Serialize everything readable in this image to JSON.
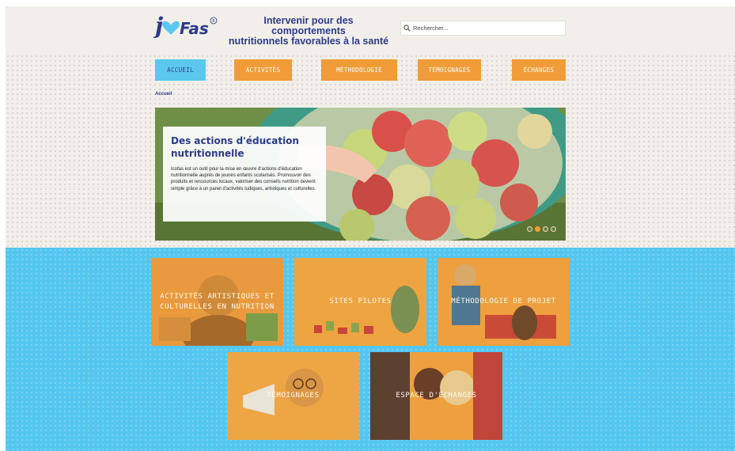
{
  "header": {
    "logo_text": "icofas",
    "tagline_line1": "Intervenir pour des comportements",
    "tagline_line2": "nutritionnels favorables à la santé",
    "search_placeholder": "Rechercher..."
  },
  "nav": [
    {
      "label": "ACCUEIL",
      "active": true
    },
    {
      "label": "ACTIVITÉS",
      "active": false
    },
    {
      "label": "MÉTHODOLOGIE",
      "active": false
    },
    {
      "label": "TÉMOIGNAGES",
      "active": false
    },
    {
      "label": "ÉCHANGES",
      "active": false
    }
  ],
  "breadcrumb": "Accueil",
  "hero": {
    "title": "Des actions d'éducation nutritionnelle",
    "text": "Icofas est un outil pour la mise en œuvre d'actions d'éducation nutritionnelle auprès de jeunes enfants scolarisés. Promouvoir des produits et ressources locaux, valoriser des conseils nutrition devient simple grâce à un panel d'activités ludiques, artistiques et culturelles.",
    "slides_count": 4,
    "active_slide": 2
  },
  "tiles": [
    {
      "label": "ACTIVITÉS ARTISTIQUES ET CULTURELLES EN NUTRITION"
    },
    {
      "label": "SITES PILOTES"
    },
    {
      "label": "MÉTHODOLOGIE DE PROJET"
    },
    {
      "label": "TÉMOIGNAGES"
    },
    {
      "label": "ESPACE D'ÉCHANGES"
    }
  ],
  "colors": {
    "navy": "#2d3a8c",
    "orange": "#f19c38",
    "sky": "#5ac8ef",
    "background": "#f2efea"
  }
}
